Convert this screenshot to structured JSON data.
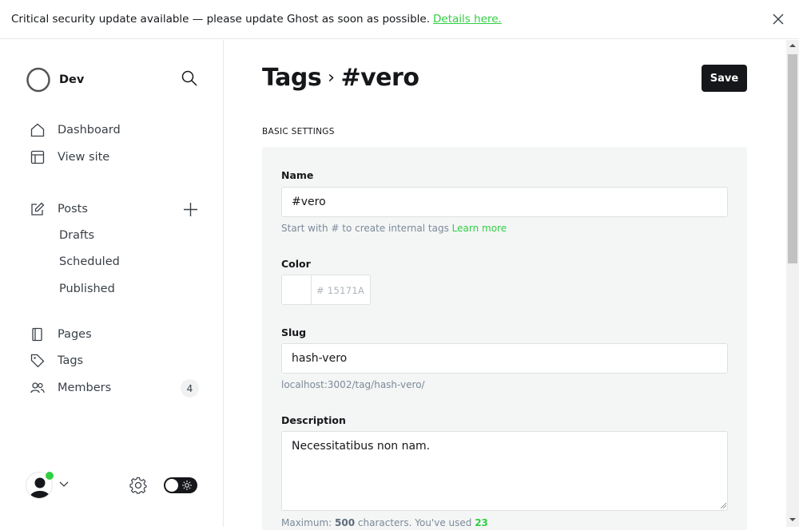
{
  "banner": {
    "message": "Critical security update available — please update Ghost as soon as possible.",
    "link": "Details here."
  },
  "sidebar": {
    "site_name": "Dev",
    "items": [
      {
        "label": "Dashboard"
      },
      {
        "label": "View site"
      },
      {
        "label": "Posts"
      },
      {
        "label": "Pages"
      },
      {
        "label": "Tags"
      },
      {
        "label": "Members",
        "count": "4"
      }
    ],
    "post_subitems": [
      {
        "label": "Drafts"
      },
      {
        "label": "Scheduled"
      },
      {
        "label": "Published"
      }
    ]
  },
  "header": {
    "breadcrumb_parent": "Tags",
    "breadcrumb_current": "#vero",
    "save_label": "Save"
  },
  "form": {
    "section_title": "BASIC SETTINGS",
    "name": {
      "label": "Name",
      "value": "#vero",
      "hint": "Start with # to create internal tags",
      "hint_link": "Learn more"
    },
    "color": {
      "label": "Color",
      "hash": "#",
      "value": "15171A"
    },
    "slug": {
      "label": "Slug",
      "value": "hash-vero",
      "url": "localhost:3002/tag/hash-vero/"
    },
    "description": {
      "label": "Description",
      "value": "Necessitatibus non nam.",
      "hint_prefix": "Maximum:",
      "max": "500",
      "hint_mid": "characters. You've used",
      "used": "23"
    }
  },
  "colors": {
    "accent": "#30cf43",
    "dark": "#15171a"
  }
}
